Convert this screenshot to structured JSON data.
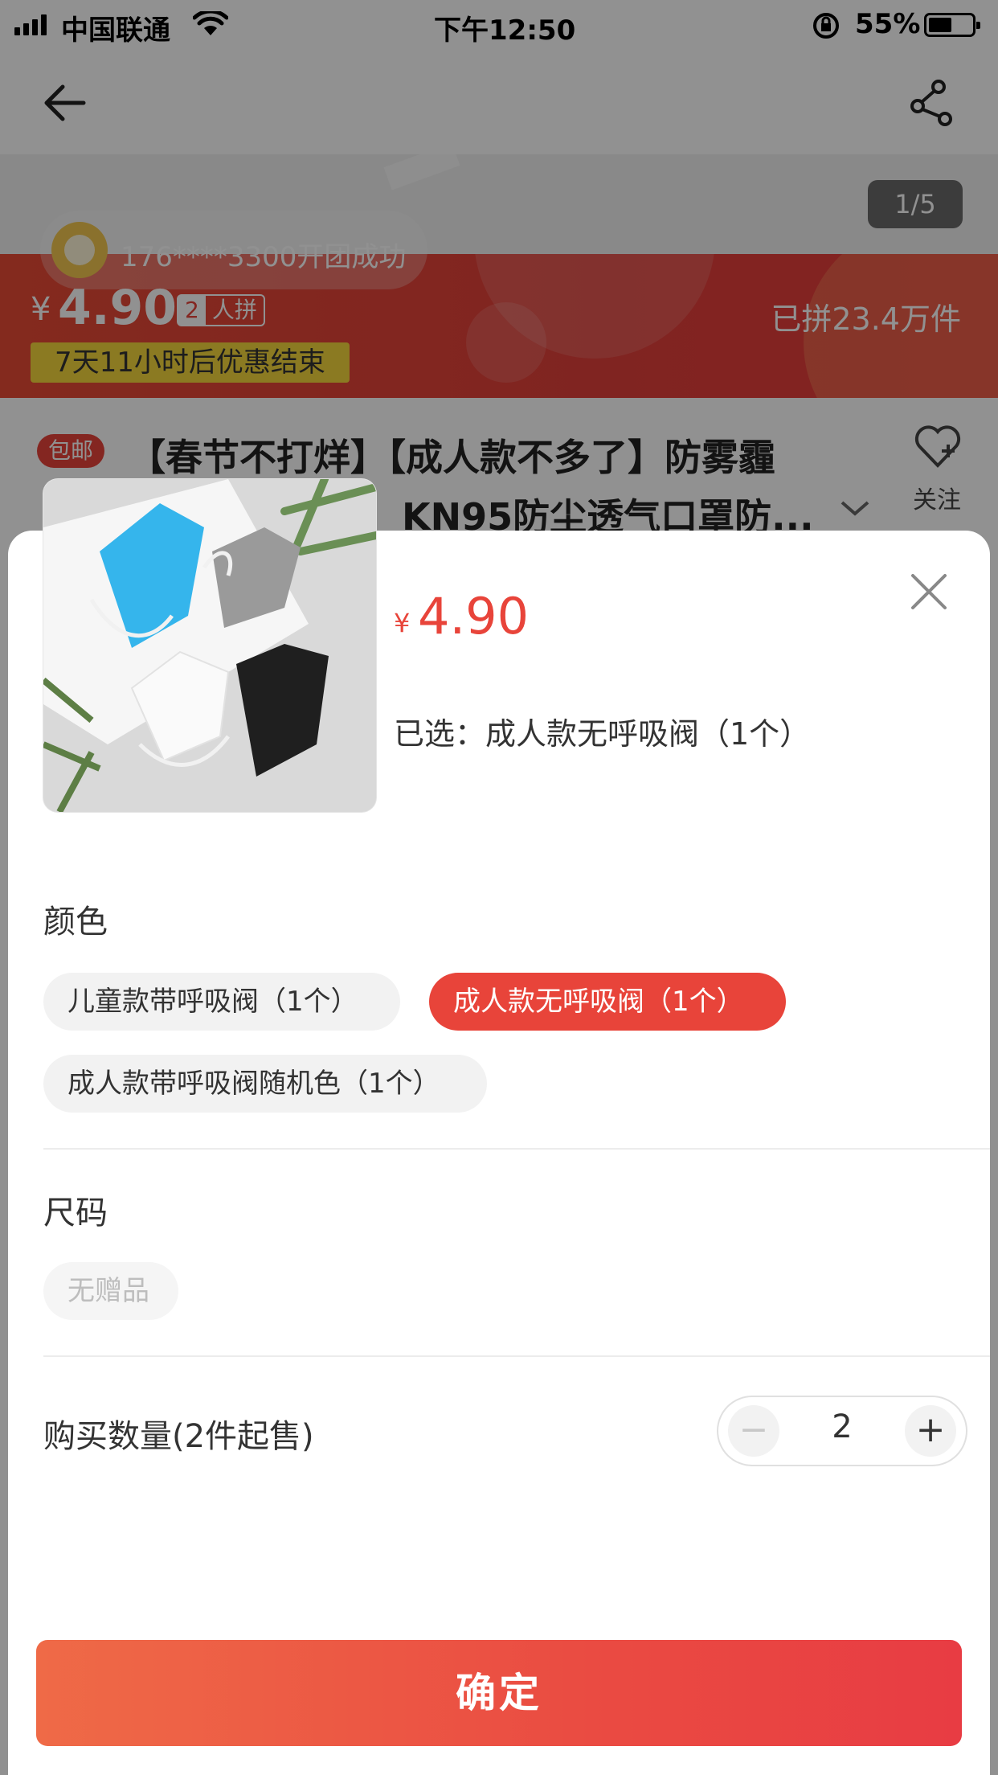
{
  "status_bar": {
    "carrier": "中国联通",
    "time": "下午12:50",
    "battery": "55%"
  },
  "product_page": {
    "image_counter": "1/5",
    "group_notice": "176****3300开团成功",
    "price_currency": "¥",
    "price": "4.90",
    "group_size": "2",
    "group_label": "人拼",
    "countdown": "7天11小时后优惠结束",
    "sold_count": "已拼23.4万件",
    "free_shipping_badge": "包邮",
    "title_line1": "【春节不打烊】【成人款不多了】防雾霾",
    "title_line2": "KN95防尘透气口罩防...",
    "follow_label": "关注"
  },
  "sheet": {
    "price_currency": "¥",
    "price": "4.90",
    "selected_text": "已选：成人款无呼吸阀（1个）",
    "color_section": {
      "title": "颜色",
      "options": [
        {
          "label": "儿童款带呼吸阀（1个）",
          "state": "normal"
        },
        {
          "label": "成人款无呼吸阀（1个）",
          "state": "selected"
        },
        {
          "label": "成人款带呼吸阀随机色（1个）",
          "state": "normal"
        }
      ]
    },
    "size_section": {
      "title": "尺码",
      "options": [
        {
          "label": "无赠品",
          "state": "disabled"
        }
      ]
    },
    "quantity": {
      "label": "购买数量(2件起售)",
      "value": "2",
      "minus": "−",
      "plus": "+"
    },
    "confirm_label": "确定"
  },
  "colors": {
    "accent": "#e8443a",
    "promo_yellow": "#f5d63c"
  }
}
